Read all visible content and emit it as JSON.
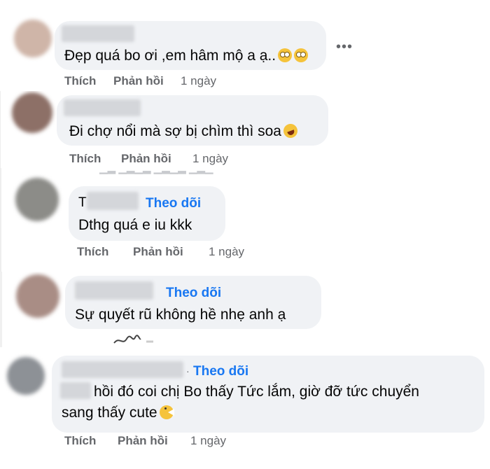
{
  "comments": [
    {
      "text": "Đẹp quá bo ơi ,em hâm mộ a ạ..",
      "emoji": [
        "face-with-rolling-eyes-icon",
        "face-with-rolling-eyes-icon"
      ],
      "actions": {
        "like": "Thích",
        "reply": "Phản hồi",
        "time": "1 ngày"
      },
      "more": "•••"
    },
    {
      "text": "Đi chợ nổi mà sợ bị chìm thì soa",
      "emoji": [
        "rolling-on-floor-laughing-icon"
      ],
      "actions": {
        "like": "Thích",
        "reply": "Phản hồi",
        "time": "1 ngày"
      }
    },
    {
      "name_initial": "T",
      "follow": "Theo dõi",
      "text": "Dthg quá e iu kkk",
      "actions": {
        "like": "Thích",
        "reply": "Phản hồi",
        "time": "1 ngày"
      }
    },
    {
      "follow": "Theo dõi",
      "text": "Sự quyết rũ không hề nhẹ anh ạ"
    },
    {
      "follow": "Theo dõi",
      "dot": "·",
      "text_line1": "hồi đó coi chị Bo thấy Tức lắm, giờ đỡ tức chuyển",
      "text_line2": "sang thấy cute",
      "emoji": [
        "pac-man-face-icon"
      ],
      "actions": {
        "like": "Thích",
        "reply": "Phản hồi",
        "time": "1 ngày"
      }
    }
  ],
  "colors": {
    "bubble": "#f0f2f5",
    "follow": "#1877f2",
    "meta": "#65676b"
  }
}
